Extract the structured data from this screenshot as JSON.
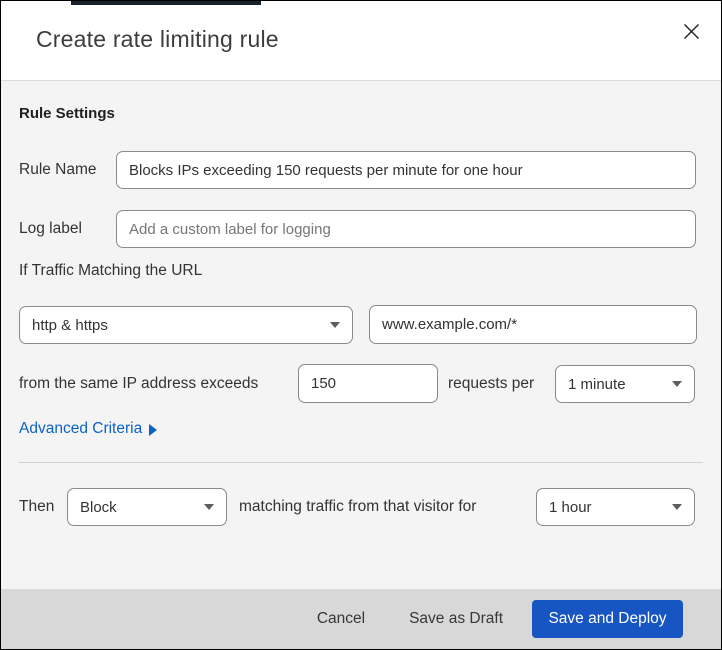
{
  "dialog": {
    "title": "Create rate limiting rule"
  },
  "icons": {
    "close": "✕"
  },
  "rule_settings": {
    "heading": "Rule Settings",
    "rule_name": {
      "label": "Rule Name",
      "value": "Blocks IPs exceeding 150 requests per minute for one hour"
    },
    "log_label": {
      "label": "Log label",
      "placeholder": "Add a custom label for logging"
    },
    "traffic_match": {
      "intro": "If Traffic Matching the URL",
      "scheme_select": {
        "value": "http & https"
      },
      "url_input": {
        "value": "www.example.com/*"
      },
      "threshold_prefix": "from the same IP address exceeds",
      "threshold_value": "150",
      "threshold_suffix": "requests per",
      "period_select": {
        "value": "1 minute"
      }
    },
    "advanced_criteria": {
      "label": "Advanced Criteria"
    }
  },
  "then_section": {
    "label": "Then",
    "action_select": {
      "value": "Block"
    },
    "middle_text": "matching traffic from that visitor for",
    "duration_select": {
      "value": "1 hour"
    }
  },
  "footer": {
    "cancel_label": "Cancel",
    "save_draft_label": "Save as Draft",
    "save_deploy_label": "Save and Deploy"
  },
  "colors": {
    "accent_blue": "#1655c2",
    "link_blue": "#0b62c6",
    "content_bg": "#f4f4f4",
    "footer_bg": "#d8d8d8"
  }
}
